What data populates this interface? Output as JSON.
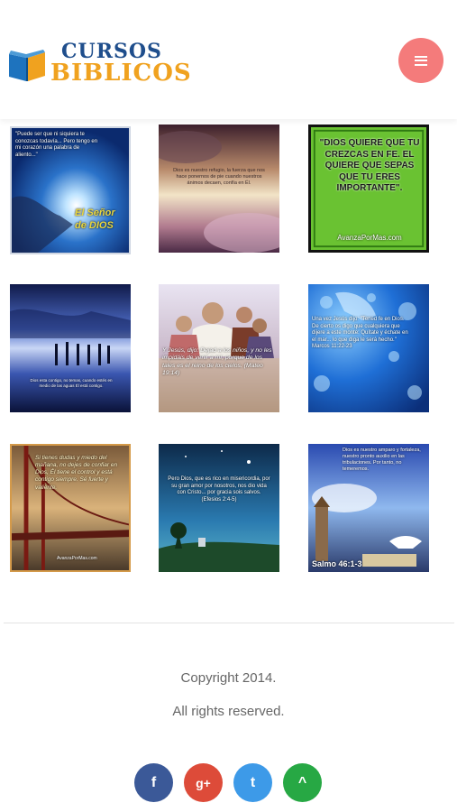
{
  "header": {
    "logo_line1": "CURSOS",
    "logo_line2": "BIBLICOS",
    "brand_blue": "#1f4e8c",
    "brand_orange": "#f0a21f",
    "menu_color": "#f47b7b"
  },
  "gallery": [
    {
      "caption": "\"Puede ser que ni siquiera te conozcas todavía... Pero tengo en mi corazón una palabra de aliento...\"",
      "signature": "El Señor de DIOS"
    },
    {
      "caption": "Dios es nuestro refugio, la fuerza que nos hace ponernos de pie cuando nuestros ánimos decaen, confía en Él."
    },
    {
      "caption": "\"DIOS QUIERE QUE TU CREZCAS EN FE. EL QUIERE QUE SEPAS QUE TU ERES IMPORTANTE\".",
      "source": "AvanzaPorMas.com"
    },
    {
      "caption": "Dios esta contigo, no temas, cuando estés en medio de las aguas Él está contigo."
    },
    {
      "caption": "Y Jesús, dijo: Dejad a los niños, y no les impidáis de venir a mí; porque de los tales es el reino de los cielos. (Mateo 19:14)"
    },
    {
      "caption": "Una vez Jesús dijo: \"Tened fe en Dios. De cierto os digo que cualquiera que dijere a este monte: Quítate y échate en el mar... lo que diga le será hecho.\" Marcos 11:22-23"
    },
    {
      "caption": "Si tienes dudas y miedo del mañana, no dejes de confiar en Dios, Él tiene el control y está contigo siempre. Sé fuerte y valiente.",
      "source": "AvanzaPorMas.com"
    },
    {
      "caption": "Pero Dios, que es rico en misericordia, por su gran amor por nosotros, nos dio vida con Cristo... por gracia sois salvos. (Efesios 2:4-5)"
    },
    {
      "caption": "Dios es nuestro amparo y fortaleza, nuestro pronto auxilio en las tribulaciones. Por tanto, no temeremos.",
      "reference": "Salmo 46:1-3"
    }
  ],
  "footer": {
    "copyright": "Copyright 2014.",
    "rights": "All rights reserved.",
    "social": [
      {
        "name": "facebook",
        "glyph": "f",
        "color": "#3b5998"
      },
      {
        "name": "google-plus",
        "glyph": "g+",
        "color": "#dd4b39"
      },
      {
        "name": "twitter",
        "glyph": "t",
        "color": "#3d9ae8"
      },
      {
        "name": "back-to-top",
        "glyph": "^",
        "color": "#27a844"
      }
    ]
  }
}
